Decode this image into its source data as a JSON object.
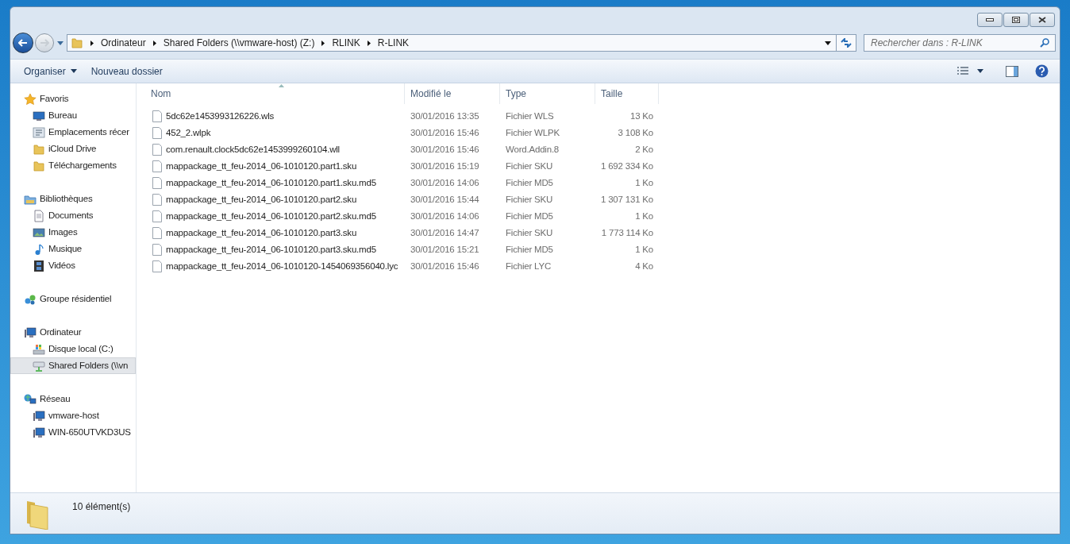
{
  "address_bar": {
    "breadcrumbs": [
      "Ordinateur",
      "Shared Folders (\\\\vmware-host) (Z:)",
      "RLINK",
      "R-LINK"
    ]
  },
  "search": {
    "placeholder": "Rechercher dans : R-LINK"
  },
  "toolbar": {
    "buttons": [
      {
        "label": "Organiser",
        "dropdown": true
      },
      {
        "label": "Nouveau dossier",
        "dropdown": false
      }
    ]
  },
  "sidebar": {
    "groups": [
      {
        "label": "Favoris",
        "kind": "star",
        "selected": false,
        "children": [
          {
            "label": "Bureau",
            "kind": "desktop",
            "selected": false
          },
          {
            "label": "Emplacements récer",
            "kind": "recent",
            "selected": false
          },
          {
            "label": "iCloud Drive",
            "kind": "folder",
            "selected": false
          },
          {
            "label": "Téléchargements",
            "kind": "folder",
            "selected": false
          }
        ]
      },
      {
        "label": "Bibliothèques",
        "kind": "library",
        "selected": false,
        "children": [
          {
            "label": "Documents",
            "kind": "document",
            "selected": false
          },
          {
            "label": "Images",
            "kind": "image",
            "selected": false
          },
          {
            "label": "Musique",
            "kind": "music",
            "selected": false
          },
          {
            "label": "Vidéos",
            "kind": "video",
            "selected": false
          }
        ]
      },
      {
        "label": "Groupe résidentiel",
        "kind": "homegroup",
        "selected": false
      },
      {
        "label": "Ordinateur",
        "kind": "computer",
        "selected": false,
        "children": [
          {
            "label": "Disque local (C:)",
            "kind": "disk",
            "selected": false
          },
          {
            "label": "Shared Folders (\\\\vn",
            "kind": "netdrive",
            "selected": true
          }
        ]
      },
      {
        "label": "Réseau",
        "kind": "network",
        "selected": false,
        "children": [
          {
            "label": "vmware-host",
            "kind": "computer",
            "selected": false
          },
          {
            "label": "WIN-650UTVKD3US",
            "kind": "computer",
            "selected": false
          }
        ]
      }
    ]
  },
  "table": {
    "columns": [
      "Nom",
      "Modifié le",
      "Type",
      "Taille"
    ],
    "rows": [
      {
        "name": "5dc62e1453993126226.wls",
        "modified": "30/01/2016 13:35",
        "type": "Fichier WLS",
        "size": "13 Ko"
      },
      {
        "name": "452_2.wlpk",
        "modified": "30/01/2016 15:46",
        "type": "Fichier WLPK",
        "size": "3 108 Ko"
      },
      {
        "name": "com.renault.clock5dc62e1453999260104.wll",
        "modified": "30/01/2016 15:46",
        "type": "Word.Addin.8",
        "size": "2 Ko"
      },
      {
        "name": "mappackage_tt_feu-2014_06-1010120.part1.sku",
        "modified": "30/01/2016 15:19",
        "type": "Fichier SKU",
        "size": "1 692 334 Ko"
      },
      {
        "name": "mappackage_tt_feu-2014_06-1010120.part1.sku.md5",
        "modified": "30/01/2016 14:06",
        "type": "Fichier MD5",
        "size": "1 Ko"
      },
      {
        "name": "mappackage_tt_feu-2014_06-1010120.part2.sku",
        "modified": "30/01/2016 15:44",
        "type": "Fichier SKU",
        "size": "1 307 131 Ko"
      },
      {
        "name": "mappackage_tt_feu-2014_06-1010120.part2.sku.md5",
        "modified": "30/01/2016 14:06",
        "type": "Fichier MD5",
        "size": "1 Ko"
      },
      {
        "name": "mappackage_tt_feu-2014_06-1010120.part3.sku",
        "modified": "30/01/2016 14:47",
        "type": "Fichier SKU",
        "size": "1 773 114 Ko"
      },
      {
        "name": "mappackage_tt_feu-2014_06-1010120.part3.sku.md5",
        "modified": "30/01/2016 15:21",
        "type": "Fichier MD5",
        "size": "1 Ko"
      },
      {
        "name": "mappackage_tt_feu-2014_06-1010120-1454069356040.lyc",
        "modified": "30/01/2016 15:46",
        "type": "Fichier LYC",
        "size": "4 Ko"
      }
    ]
  },
  "status_bar": {
    "count": "10 élément(s)"
  }
}
